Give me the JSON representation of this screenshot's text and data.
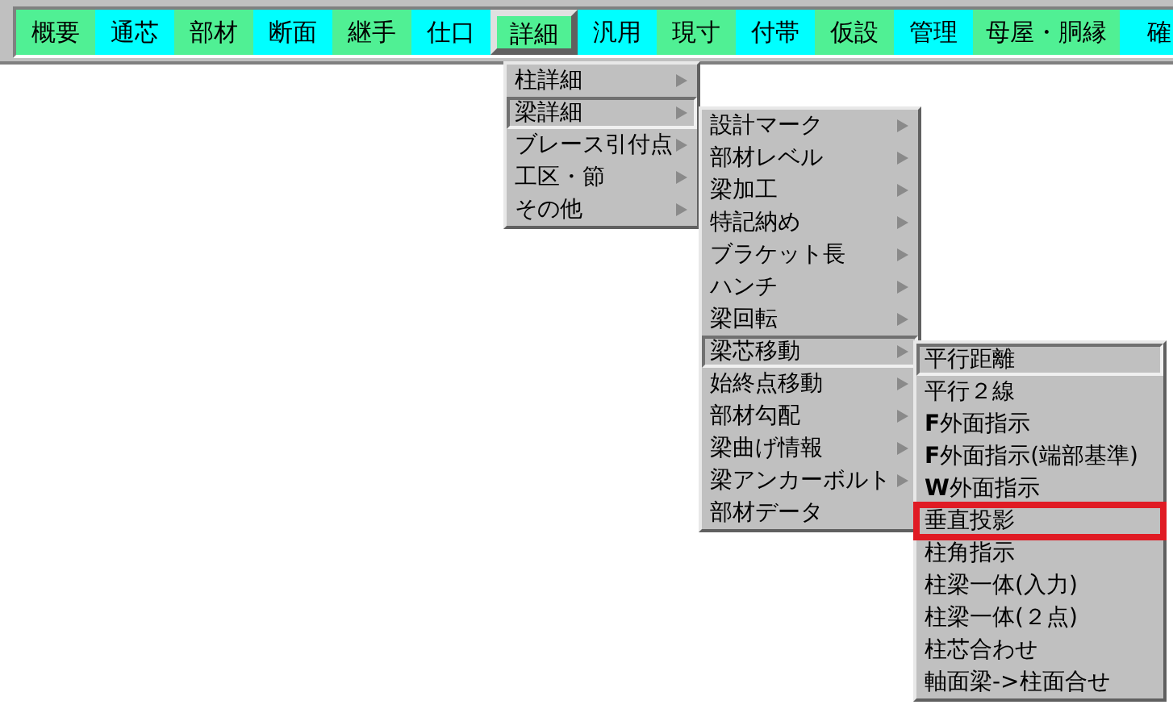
{
  "toolbar": [
    {
      "label": "概要",
      "color": "#50f094",
      "selected": false
    },
    {
      "label": "通芯",
      "color": "#00ffff",
      "selected": false
    },
    {
      "label": "部材",
      "color": "#50f094",
      "selected": false
    },
    {
      "label": "断面",
      "color": "#00ffff",
      "selected": false
    },
    {
      "label": "継手",
      "color": "#50f094",
      "selected": false
    },
    {
      "label": "仕口",
      "color": "#00ffff",
      "selected": false
    },
    {
      "label": "詳細",
      "color": "#50f094",
      "selected": true
    },
    {
      "label": "汎用",
      "color": "#00ffff",
      "selected": false
    },
    {
      "label": "現寸",
      "color": "#50f094",
      "selected": false
    },
    {
      "label": "付帯",
      "color": "#00ffff",
      "selected": false
    },
    {
      "label": "仮設",
      "color": "#50f094",
      "selected": false
    },
    {
      "label": "管理",
      "color": "#00ffff",
      "selected": false
    },
    {
      "label": "母屋・胴縁",
      "color": "#50f094",
      "selected": false
    },
    {
      "label": "確",
      "color": "#00ffff",
      "selected": false
    }
  ],
  "menus": [
    {
      "items": [
        {
          "label": "柱詳細",
          "submenu": true,
          "selected": false
        },
        {
          "label": "梁詳細",
          "submenu": true,
          "selected": true
        },
        {
          "label": "ブレース引付点",
          "submenu": true,
          "selected": false
        },
        {
          "label": "工区・節",
          "submenu": true,
          "selected": false
        },
        {
          "label": "その他",
          "submenu": true,
          "selected": false
        }
      ]
    },
    {
      "items": [
        {
          "label": "設計マーク",
          "submenu": true,
          "selected": false
        },
        {
          "label": "部材レベル",
          "submenu": true,
          "selected": false
        },
        {
          "label": "梁加工",
          "submenu": true,
          "selected": false
        },
        {
          "label": "特記納め",
          "submenu": true,
          "selected": false
        },
        {
          "label": "ブラケット長",
          "submenu": true,
          "selected": false
        },
        {
          "label": "ハンチ",
          "submenu": true,
          "selected": false
        },
        {
          "label": "梁回転",
          "submenu": true,
          "selected": false
        },
        {
          "label": "梁芯移動",
          "submenu": true,
          "selected": true
        },
        {
          "label": "始終点移動",
          "submenu": true,
          "selected": false
        },
        {
          "label": "部材勾配",
          "submenu": true,
          "selected": false
        },
        {
          "label": "梁曲げ情報",
          "submenu": true,
          "selected": false
        },
        {
          "label": "梁アンカーボルト",
          "submenu": true,
          "selected": false
        },
        {
          "label": "部材データ",
          "submenu": false,
          "selected": false
        }
      ]
    },
    {
      "items": [
        {
          "label": "平行距離",
          "submenu": false,
          "selected": true,
          "outlined": false
        },
        {
          "label": "平行２線",
          "submenu": false,
          "selected": false,
          "outlined": false
        },
        {
          "label": "**F**外面指示",
          "submenu": false,
          "selected": false,
          "outlined": false
        },
        {
          "label": "**F**外面指示(端部基準)",
          "submenu": false,
          "selected": false,
          "outlined": false
        },
        {
          "label": "**W**外面指示",
          "submenu": false,
          "selected": false,
          "outlined": false
        },
        {
          "label": "垂直投影",
          "submenu": false,
          "selected": false,
          "outlined": true
        },
        {
          "label": "柱角指示",
          "submenu": false,
          "selected": false,
          "outlined": false
        },
        {
          "label": "柱梁一体(入力)",
          "submenu": false,
          "selected": false,
          "outlined": false
        },
        {
          "label": "柱梁一体(２点)",
          "submenu": false,
          "selected": false,
          "outlined": false
        },
        {
          "label": "柱芯合わせ",
          "submenu": false,
          "selected": false,
          "outlined": false
        },
        {
          "label": "軸面梁->柱面合せ",
          "submenu": false,
          "selected": false,
          "outlined": false
        }
      ]
    }
  ]
}
